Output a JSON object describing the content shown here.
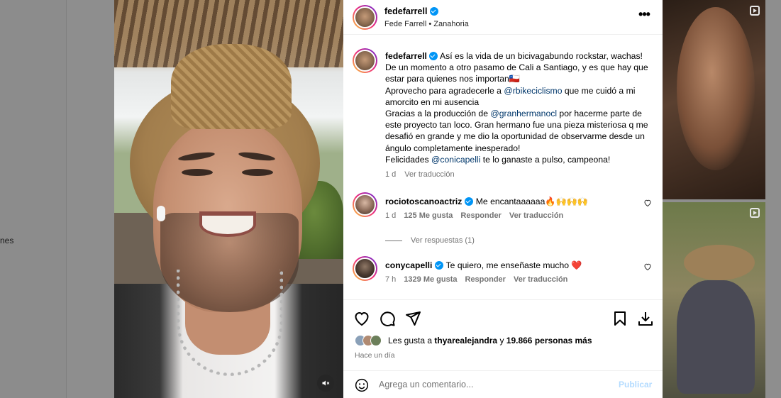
{
  "background": {
    "left_partial_text": "nes"
  },
  "post": {
    "author": "fedefarrell",
    "subtitle": "Fede Farrell • Zanahoria",
    "caption_parts": {
      "line1": "Así es la vida de un bicivagabundo rockstar, wachas! De un momento a otro pasamo de Cali a Santiago, y es que hay que estar para quienes nos importan🇨🇱",
      "line2a": "Aprovecho para agradecerle a ",
      "mention1": "@rbikeciclismo",
      "line2b": " que me cuidó a mi amorcito en mi ausencia",
      "line3a": "Gracias a la producción de ",
      "mention2": "@granhermanocl",
      "line3b": " por hacerme parte de este proyecto tan loco. Gran hermano fue una pieza misteriosa q me desafió en grande y me dio la oportunidad de observarme desde un ángulo completamente inesperado!",
      "line4a": "Felicidades ",
      "mention3": "@conicapelli",
      "line4b": " te lo ganaste a pulso, campeona!"
    },
    "caption_time": "1 d",
    "see_translation": "Ver traducción"
  },
  "comments": [
    {
      "user": "rociotoscanoactriz",
      "text": "Me encantaaaaaa🔥🙌🙌🙌",
      "time": "1 d",
      "likes": "125 Me gusta",
      "reply": "Responder",
      "translate": "Ver traducción",
      "view_replies": "Ver respuestas (1)"
    },
    {
      "user": "conycapelli",
      "text": "Te quiero, me enseñaste mucho ❤️",
      "time": "7 h",
      "likes": "1329 Me gusta",
      "reply": "Responder",
      "translate": "Ver traducción"
    }
  ],
  "likes": {
    "prefix": "Les gusta a ",
    "user": "thyarealejandra",
    "middle": " y ",
    "others": "19.866 personas más"
  },
  "time_ago": "Hace un día",
  "add_comment": {
    "placeholder": "Agrega un comentario...",
    "publish": "Publicar"
  },
  "colors": {
    "accent": "#0095f6",
    "link": "#00376b",
    "muted": "#737373",
    "publish_disabled": "#b3dbff",
    "heart_red": "#ed4956"
  },
  "icons": [
    "more-icon",
    "heart-icon",
    "comment-icon",
    "share-icon",
    "bookmark-icon",
    "download-icon",
    "emoji-icon",
    "mute-icon",
    "verified-icon",
    "reel-icon"
  ]
}
